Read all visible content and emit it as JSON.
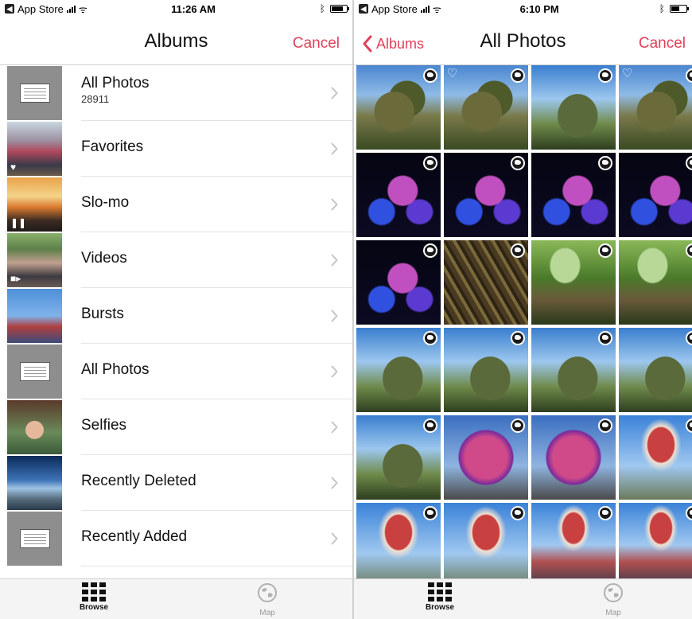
{
  "left": {
    "status": {
      "carrier": "App Store",
      "time": "11:26 AM"
    },
    "nav": {
      "title": "Albums",
      "cancel": "Cancel"
    },
    "albums": [
      {
        "name": "All Photos",
        "count": "28911",
        "thumb": "screenshot"
      },
      {
        "name": "Favorites",
        "count": "",
        "thumb": "crowd",
        "badge": "heart"
      },
      {
        "name": "Slo-mo",
        "count": "",
        "thumb": "sunset",
        "badge": "pause"
      },
      {
        "name": "Videos",
        "count": "",
        "thumb": "crowd2",
        "badge": "video"
      },
      {
        "name": "Bursts",
        "count": "",
        "thumb": "balloon"
      },
      {
        "name": "All Photos",
        "count": "",
        "thumb": "screenshot"
      },
      {
        "name": "Selfies",
        "count": "",
        "thumb": "selfie"
      },
      {
        "name": "Recently Deleted",
        "count": "",
        "thumb": "sky"
      },
      {
        "name": "Recently Added",
        "count": "",
        "thumb": "screenshot"
      }
    ],
    "tabs": {
      "browse": "Browse",
      "map": "Map"
    }
  },
  "right": {
    "status": {
      "carrier": "App Store",
      "time": "6:10 PM"
    },
    "nav": {
      "back": "Albums",
      "title": "All Photos",
      "cancel": "Cancel"
    },
    "photos": [
      {
        "scene": "rock",
        "heart": false
      },
      {
        "scene": "rock",
        "heart": true
      },
      {
        "scene": "rock-sky",
        "heart": false
      },
      {
        "scene": "rock",
        "heart": true
      },
      {
        "scene": "night",
        "heart": false
      },
      {
        "scene": "night",
        "heart": false
      },
      {
        "scene": "night",
        "heart": false
      },
      {
        "scene": "night",
        "heart": false
      },
      {
        "scene": "night",
        "heart": false
      },
      {
        "scene": "roots",
        "heart": false
      },
      {
        "scene": "forest",
        "heart": false
      },
      {
        "scene": "forest",
        "heart": false
      },
      {
        "scene": "rock-sky",
        "heart": false
      },
      {
        "scene": "rock-sky",
        "heart": false
      },
      {
        "scene": "rock-sky",
        "heart": false
      },
      {
        "scene": "rock-sky",
        "heart": false
      },
      {
        "scene": "rock-sky",
        "heart": false
      },
      {
        "scene": "sphere",
        "heart": false
      },
      {
        "scene": "sphere",
        "heart": false
      },
      {
        "scene": "balloon",
        "heart": false
      },
      {
        "scene": "balloon",
        "heart": false
      },
      {
        "scene": "balloon",
        "heart": false
      },
      {
        "scene": "balloon-crowd",
        "heart": false
      },
      {
        "scene": "balloon-crowd",
        "heart": false
      }
    ],
    "tabs": {
      "browse": "Browse",
      "map": "Map"
    }
  },
  "colors": {
    "accent": "#e0405a"
  }
}
